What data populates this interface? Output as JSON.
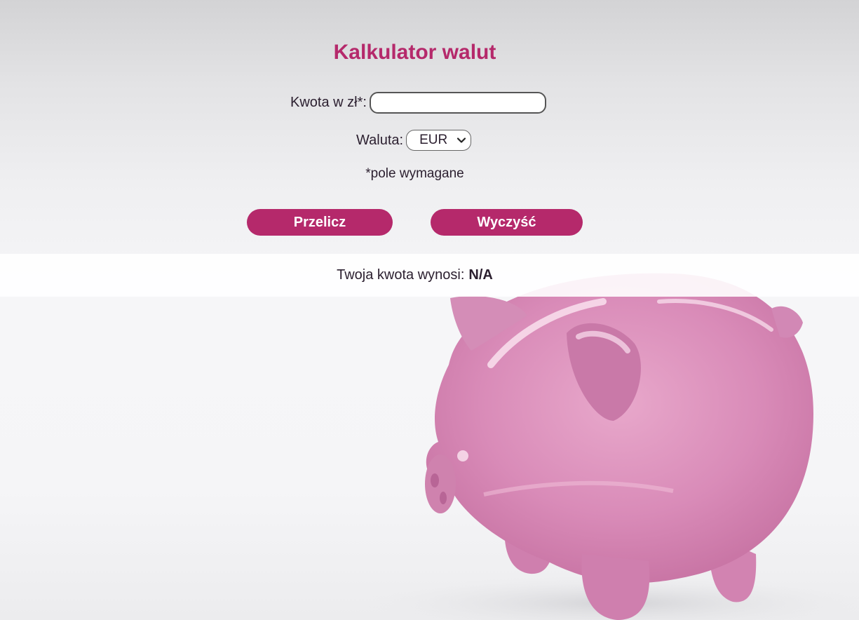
{
  "page": {
    "title": "Kalkulator walut"
  },
  "form": {
    "amount_label": "Kwota w zł*:",
    "amount_value": "",
    "currency_label": "Waluta:",
    "currency_selected": "EUR",
    "required_note": "*pole wymagane",
    "convert_button": "Przelicz",
    "clear_button": "Wyczyść"
  },
  "result": {
    "label": "Twoja kwota wynosi:",
    "value": "N/A"
  },
  "icons": {
    "select_arrow": "chevron-down-icon",
    "background": "piggy-bank-illustration"
  },
  "colors": {
    "accent": "#b5296b",
    "piggy": "#d98bb8"
  }
}
